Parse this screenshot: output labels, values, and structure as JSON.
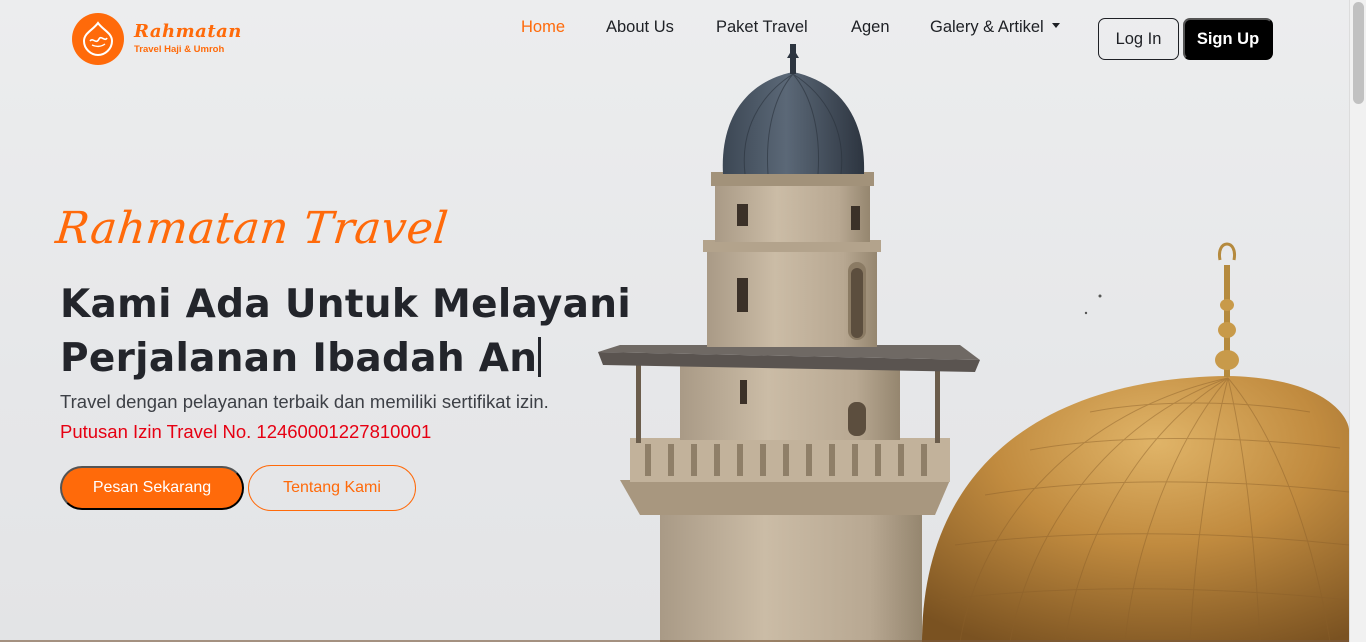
{
  "brand": {
    "name": "Rahmatan",
    "tagline": "Travel Haji & Umroh"
  },
  "nav": {
    "items": [
      {
        "label": "Home",
        "active": true
      },
      {
        "label": "About Us"
      },
      {
        "label": "Paket Travel"
      },
      {
        "label": "Agen"
      },
      {
        "label": "Galery & Artikel",
        "dropdown": true
      }
    ],
    "login": "Log In",
    "signup": "Sign Up"
  },
  "hero": {
    "script_title": "Rahmatan Travel",
    "heading_line1": "Kami Ada Untuk Melayani",
    "heading_line2": "Perjalanan Ibadah An",
    "description": "Travel dengan pelayanan terbaik dan memiliki sertifikat izin.",
    "license": "Putusan Izin Travel No. 12460001227810001",
    "primary_button": "Pesan Sekarang",
    "secondary_button": "Tentang Kami"
  },
  "colors": {
    "accent": "#ff6a0a",
    "license_red": "#e60012",
    "text_dark": "#23252b"
  }
}
